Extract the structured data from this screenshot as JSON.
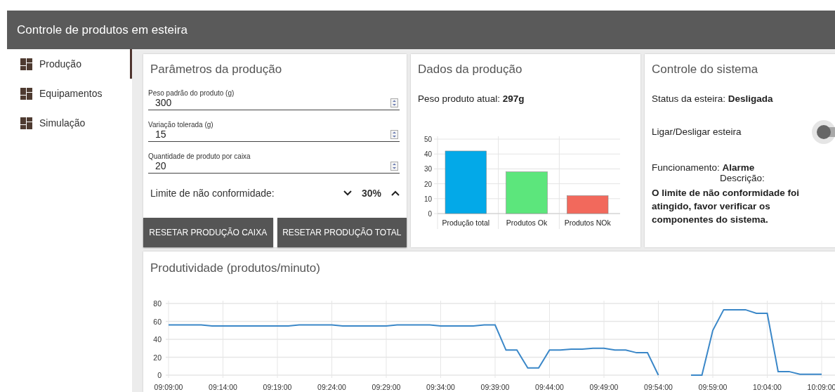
{
  "app_bar": {
    "title": "Controle de produtos em esteira"
  },
  "sidebar": {
    "items": [
      {
        "label": "Produção",
        "selected": true
      },
      {
        "label": "Equipamentos",
        "selected": false
      },
      {
        "label": "Simulação",
        "selected": false
      }
    ]
  },
  "parameters": {
    "title": "Parâmetros da produção",
    "fields": [
      {
        "label": "Peso padrão do produto (g)",
        "value": "300"
      },
      {
        "label": "Variação tolerada (g)",
        "value": "15"
      },
      {
        "label": "Quantidade de produto por caixa",
        "value": "20"
      }
    ],
    "limit": {
      "label": "Limite de não conformidade:",
      "value": "30%"
    },
    "buttons": [
      "RESETAR PRODUÇÃO CAIXA",
      "RESETAR PRODUÇÃO TOTAL"
    ]
  },
  "production_data": {
    "title": "Dados da produção",
    "current_weight": "Peso produto atual: **297g**",
    "chart_data": {
      "type": "bar",
      "categories": [
        "Produção total",
        "Produtos Ok",
        "Produtos NOk"
      ],
      "values": [
        42,
        28,
        12
      ],
      "colors": [
        "#03a9e8",
        "#5ce67c",
        "#f2695c"
      ],
      "grid": true,
      "ylim": [
        0,
        50
      ],
      "yticks": [
        0,
        10,
        20,
        30,
        40,
        50
      ]
    }
  },
  "system_control": {
    "title": "Controle do sistema",
    "status": "Status da esteira: **Desligada**",
    "toggle": {
      "label": "Ligar/Desligar esteira",
      "on": false
    },
    "operation": "Funcionamento: **Alarme**",
    "description_label": "Descrição:",
    "description": "O limite de não conformidade foi atingido, favor verificar os componentes do sistema."
  },
  "productivity": {
    "title": "Produtividade (produtos/minuto)",
    "chart_data": {
      "type": "line",
      "grid": true,
      "categories": [
        "09:09:00",
        null,
        null,
        null,
        null,
        "09:14:00",
        null,
        null,
        null,
        null,
        "09:19:00",
        null,
        null,
        null,
        null,
        "09:24:00",
        null,
        null,
        null,
        null,
        "09:29:00",
        null,
        null,
        null,
        null,
        "09:34:00",
        null,
        null,
        null,
        null,
        "09:39:00",
        null,
        null,
        null,
        null,
        "09:44:00",
        null,
        null,
        null,
        null,
        "09:49:00",
        null,
        null,
        null,
        null,
        "09:54:00",
        null,
        null,
        null,
        null,
        "09:59:00",
        null,
        null,
        null,
        null,
        "10:04:00",
        null,
        null,
        null,
        null,
        "10:09:00"
      ],
      "series": [
        {
          "color": "#3a87c8",
          "values": [
            56,
            56,
            56,
            56,
            55,
            55,
            55,
            55,
            55,
            55,
            55,
            55,
            56,
            56,
            56,
            56,
            55,
            55,
            55,
            55,
            55,
            56,
            56,
            56,
            56,
            55,
            55,
            55,
            55,
            56,
            56,
            28,
            28,
            8,
            8,
            28,
            28,
            29,
            29,
            30,
            30,
            28,
            28,
            25,
            25,
            0,
            null,
            null,
            0,
            0,
            50,
            73,
            73,
            73,
            69,
            69,
            4,
            4,
            1,
            1,
            1
          ]
        }
      ],
      "ylim": [
        0,
        80
      ],
      "yticks": [
        0,
        20,
        40,
        60,
        80
      ]
    }
  }
}
